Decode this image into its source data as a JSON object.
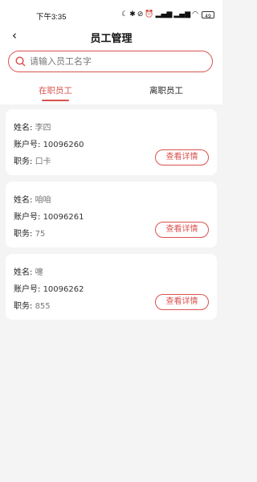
{
  "status_bar": {
    "time": "下午3:35",
    "battery": "49",
    "icons": [
      "moon-icon",
      "bluetooth-icon",
      "mute-icon",
      "alarm-icon",
      "signal-icon",
      "signal-icon",
      "wifi-icon"
    ]
  },
  "nav": {
    "back_icon": "chevron-left-icon",
    "title": "员工管理"
  },
  "search": {
    "placeholder": "请输入员工名字",
    "value": ""
  },
  "tabs": [
    {
      "label": "在职员工",
      "active": true
    },
    {
      "label": "离职员工",
      "active": false
    }
  ],
  "labels": {
    "name": "姓名:",
    "account": "账户号:",
    "position": "职务:",
    "detail_button": "查看详情"
  },
  "employees": [
    {
      "name": "李四",
      "account": "10096260",
      "position": "口卡"
    },
    {
      "name": "咱咱",
      "account": "10096261",
      "position": "75"
    },
    {
      "name": "嚏",
      "account": "10096262",
      "position": "855"
    }
  ],
  "colors": {
    "accent": "#d9534f",
    "background": "#f4f4f4",
    "card": "#ffffff"
  }
}
